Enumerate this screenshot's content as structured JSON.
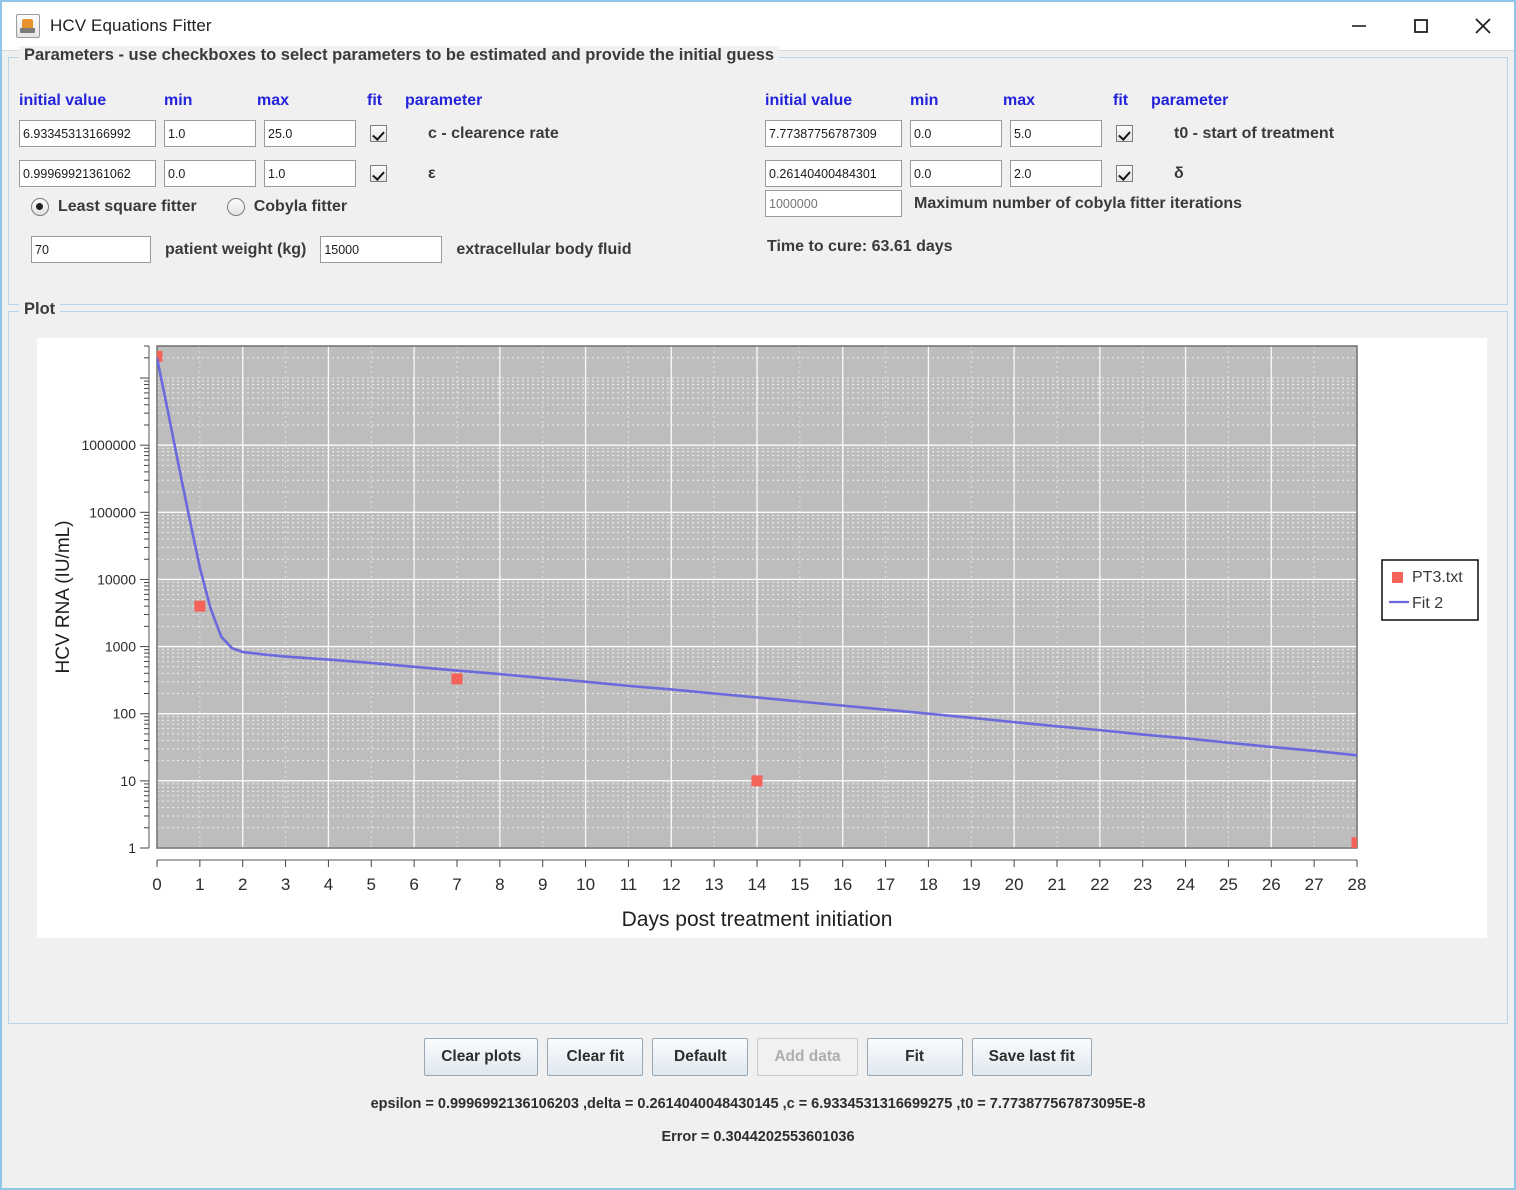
{
  "window": {
    "title": "HCV Equations Fitter",
    "app_icon": "java-coffee-cup-icon",
    "minimize": "—",
    "maximize": "□",
    "close": "✕"
  },
  "parameters_panel": {
    "legend": "Parameters - use checkboxes to select parameters to be estimated and provide the initial guess",
    "headers": {
      "initial_value": "initial value",
      "min": "min",
      "max": "max",
      "fit": "fit",
      "parameter": "parameter"
    },
    "header_color": "#2323dc",
    "left_rows": [
      {
        "initial_value": "6.93345313166992",
        "min": "1.0",
        "max": "25.0",
        "fit_checked": true,
        "label": "c - clearence rate"
      },
      {
        "initial_value": "0.99969921361062",
        "min": "0.0",
        "max": "1.0",
        "fit_checked": true,
        "label": "ε"
      }
    ],
    "right_rows": [
      {
        "initial_value": "7.77387756787309",
        "min": "0.0",
        "max": "5.0",
        "fit_checked": true,
        "label": "t0 - start of treatment"
      },
      {
        "initial_value": "0.26140400484301",
        "min": "0.0",
        "max": "2.0",
        "fit_checked": true,
        "label": "δ"
      }
    ],
    "fitter_choice": {
      "least_square_label": "Least square fitter",
      "cobyla_label": "Cobyla fitter",
      "selected": "least_square"
    },
    "patient_weight": {
      "value": "70",
      "label": "patient weight (kg)"
    },
    "extracellular_body_fluid": {
      "value": "15000",
      "label": "extracellular body fluid"
    },
    "cobyla_iterations": {
      "placeholder": "1000000",
      "value": "",
      "label": "Maximum number of cobyla fitter iterations"
    },
    "time_to_cure": "Time to cure: 63.61 days"
  },
  "plot_panel": {
    "legend": "Plot"
  },
  "chart_data": {
    "type": "line",
    "title": "",
    "xlabel": "Days post treatment initiation",
    "ylabel": "HCV RNA (IU/mL)",
    "xlim": [
      0,
      28
    ],
    "ylim": [
      1,
      30000000
    ],
    "yscale": "log",
    "xticks": [
      0,
      1,
      2,
      3,
      4,
      5,
      6,
      7,
      8,
      9,
      10,
      11,
      12,
      13,
      14,
      15,
      16,
      17,
      18,
      19,
      20,
      21,
      22,
      23,
      24,
      25,
      26,
      27,
      28
    ],
    "yticks": [
      1,
      10,
      100,
      1000,
      10000,
      100000,
      1000000
    ],
    "ytick_labels": [
      "1",
      "10",
      "100",
      "1000",
      "10000",
      "100000",
      "1000000"
    ],
    "grid": true,
    "plot_bg": "#bdbdbd",
    "grid_color": "#ffffff",
    "legend_position": "right-outside",
    "series": [
      {
        "name": "PT3.txt",
        "type": "scatter",
        "marker": "square",
        "color": "#f4635a",
        "x": [
          0,
          1,
          7,
          14,
          28
        ],
        "y": [
          21000000,
          4000,
          330,
          10,
          1.2
        ]
      },
      {
        "name": "Fit 2",
        "type": "line",
        "color": "#6a6add",
        "x": [
          0,
          0.25,
          0.5,
          0.75,
          1,
          1.25,
          1.5,
          1.75,
          2,
          2.5,
          3,
          4,
          5,
          6,
          7,
          8,
          9,
          10,
          11,
          12,
          13,
          14,
          15,
          16,
          17,
          18,
          19,
          20,
          21,
          22,
          23,
          24,
          25,
          26,
          27,
          28
        ],
        "y": [
          20000000,
          3300000,
          520000,
          85000,
          15000,
          3700,
          1400,
          950,
          830,
          760,
          710,
          640,
          570,
          500,
          440,
          390,
          340,
          300,
          260,
          230,
          200,
          175,
          152,
          132,
          115,
          100,
          87,
          75,
          65,
          57,
          49,
          43,
          37,
          32,
          28,
          24
        ]
      }
    ]
  },
  "buttons": {
    "clear_plots": "Clear plots",
    "clear_fit": "Clear fit",
    "default": "Default",
    "add_data": "Add data",
    "add_data_disabled": true,
    "fit": "Fit",
    "save_last_fit": "Save last fit"
  },
  "results": {
    "summary": "epsilon = 0.9996992136106203 ,delta = 0.2614040048430145 ,c = 6.9334531316699275 ,t0 = 7.773877567873095E-8",
    "error": "Error = 0.3044202553601036"
  }
}
